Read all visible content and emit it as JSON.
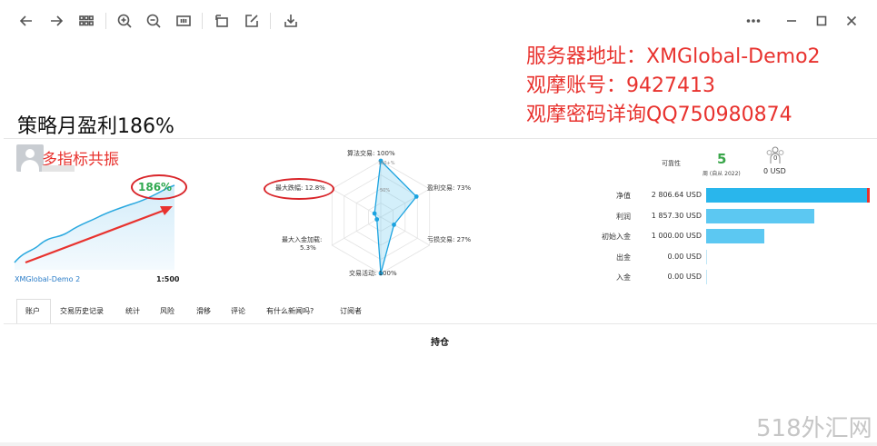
{
  "overlay": {
    "server_line": "服务器地址：XMGlobal-Demo2",
    "account_line": "观摩账号：9427413",
    "password_line": "观摩密码详询QQ750980874",
    "strategy_monthly": "策略月盈利186%"
  },
  "signal": {
    "name": "多指标共振",
    "growth_percent": "186%",
    "server": "XMGlobal-Demo 2",
    "leverage": "1:500"
  },
  "radar": {
    "algo_trading": "算法交易: 100%",
    "profit_trading": "盈利交易: 73%",
    "loss_trading": "亏损交易: 27%",
    "trade_activity": "交易活动: 100%",
    "max_deposit_load": "最大入金加载:",
    "max_deposit_load_value": "5.3%",
    "max_drawdown": "最大跌幅: 12.8%",
    "ring_100": "100+%",
    "ring_50": "50%",
    "values": [
      1.0,
      0.73,
      0.27,
      1.0,
      0.053,
      0.128
    ]
  },
  "stats": {
    "reliability_label": "可靠性",
    "weeks_value": "5",
    "weeks_label": "周 (自从 2022)",
    "subscribers_value": "0",
    "subscribers_money": "0 USD"
  },
  "bars": [
    {
      "label": "净值",
      "value": "2 806.64 USD",
      "fraction": 1.0,
      "color": "#29b6ec",
      "accent": "#e8322e"
    },
    {
      "label": "利润",
      "value": "1 857.30 USD",
      "fraction": 0.662,
      "color": "#5cc8f2",
      "accent": ""
    },
    {
      "label": "初始入金",
      "value": "1 000.00 USD",
      "fraction": 0.356,
      "color": "#5cc8f2",
      "accent": ""
    },
    {
      "label": "出金",
      "value": "0.00 USD",
      "fraction": 0,
      "color": "#5cc8f2",
      "accent": ""
    },
    {
      "label": "入金",
      "value": "0.00 USD",
      "fraction": 0,
      "color": "#5cc8f2",
      "accent": ""
    }
  ],
  "tabs": [
    "账户",
    "交易历史记录",
    "统计",
    "风险",
    "滑移",
    "评论",
    "有什么新闻吗?",
    "订阅者"
  ],
  "section_title": "持仓",
  "watermark": "518外汇网"
}
